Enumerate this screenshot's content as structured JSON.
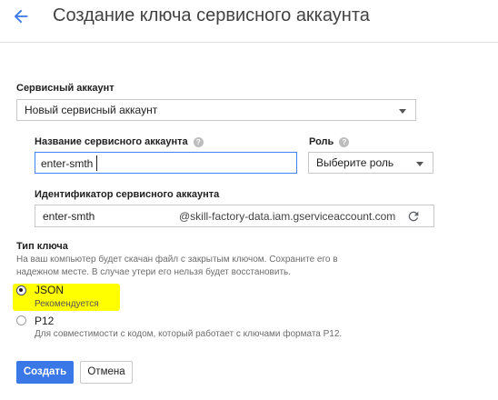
{
  "header": {
    "title": "Создание ключа сервисного аккаунта",
    "back_icon": "arrow-back-icon"
  },
  "colors": {
    "accent": "#3b78e7",
    "highlight": "#ffff00"
  },
  "service_account": {
    "label": "Сервисный аккаунт",
    "selected": "Новый сервисный аккаунт"
  },
  "account_name": {
    "label": "Название сервисного аккаунта",
    "value": "enter-smth"
  },
  "role": {
    "label": "Роль",
    "selected": "Выберите роль"
  },
  "account_id": {
    "label": "Идентификатор сервисного аккаунта",
    "value": "enter-smth",
    "suffix": "@skill-factory-data.iam.gserviceaccount.com",
    "refresh_icon": "refresh-icon"
  },
  "key_type": {
    "label": "Тип ключа",
    "desc_line1": "На ваш компьютер будет скачан файл с закрытым ключом. Сохраните его в",
    "desc_line2": "надежном месте. В случае утери его нельзя будет восстановить.",
    "options": [
      {
        "label": "JSON",
        "hint": "Рекомендуется",
        "selected": true
      },
      {
        "label": "P12",
        "hint": "Для совместимости с кодом, который работает с ключами формата P12.",
        "selected": false
      }
    ]
  },
  "actions": {
    "create": "Создать",
    "cancel": "Отмена"
  }
}
